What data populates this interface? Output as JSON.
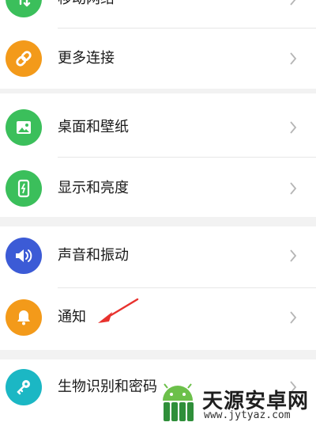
{
  "settings": {
    "rows": [
      {
        "label": "移动网络",
        "icon": "mobile-network-icon",
        "color": "#3bbf5b"
      },
      {
        "label": "更多连接",
        "icon": "link-icon",
        "color": "#f39a1a"
      },
      {
        "label": "桌面和壁纸",
        "icon": "image-icon",
        "color": "#3bbf5b"
      },
      {
        "label": "显示和亮度",
        "icon": "phone-brightness-icon",
        "color": "#3bbf5b"
      },
      {
        "label": "声音和振动",
        "icon": "speaker-icon",
        "color": "#3c5bd6"
      },
      {
        "label": "通知",
        "icon": "bell-icon",
        "color": "#f39a1a"
      },
      {
        "label": "生物识别和密码",
        "icon": "key-icon",
        "color": "#1bb7c4"
      }
    ]
  },
  "annotation": {
    "arrow_color": "#e8322e"
  },
  "watermark": {
    "name": "天源安卓网",
    "url": "www.jytyaz.com"
  }
}
